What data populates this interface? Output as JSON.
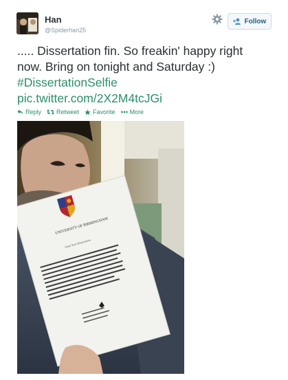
{
  "user": {
    "name": "Han",
    "handle": "@Spiderhan25"
  },
  "header": {
    "follow_label": "Follow"
  },
  "tweet": {
    "line1": "..... Dissertation fin. So freakin' happy right",
    "line2": "now. Bring on tonight and Saturday :)",
    "hashtag": "#DissertationSelfie",
    "pic_link": "pic.twitter.com/2X2M4tcJGi"
  },
  "actions": {
    "reply": "Reply",
    "retweet": "Retweet",
    "favorite": "Favorite",
    "more": "More"
  },
  "photo": {
    "doc_university": "UNIVERSITY OF BIRMINGHAM",
    "doc_title": "Final Year Dissertation",
    "doc_abstract": "Discuss how cross-dressers in pantomime and film from the 20th century are represented and portrayed with the use of comic devices, costumes, stereotyping and audience reactions, and also focusing on why transvestism is to an extent accepted on stage and screen, but not in history sex-gender systems in society.",
    "doc_footer": "Student ID Number 1190xx Submitted 2nd May 2014 Word Count 8000"
  },
  "colors": {
    "link": "#2a8f6a",
    "text": "#292f33",
    "meta": "#8899a6",
    "follow_text": "#1f5f8b"
  }
}
